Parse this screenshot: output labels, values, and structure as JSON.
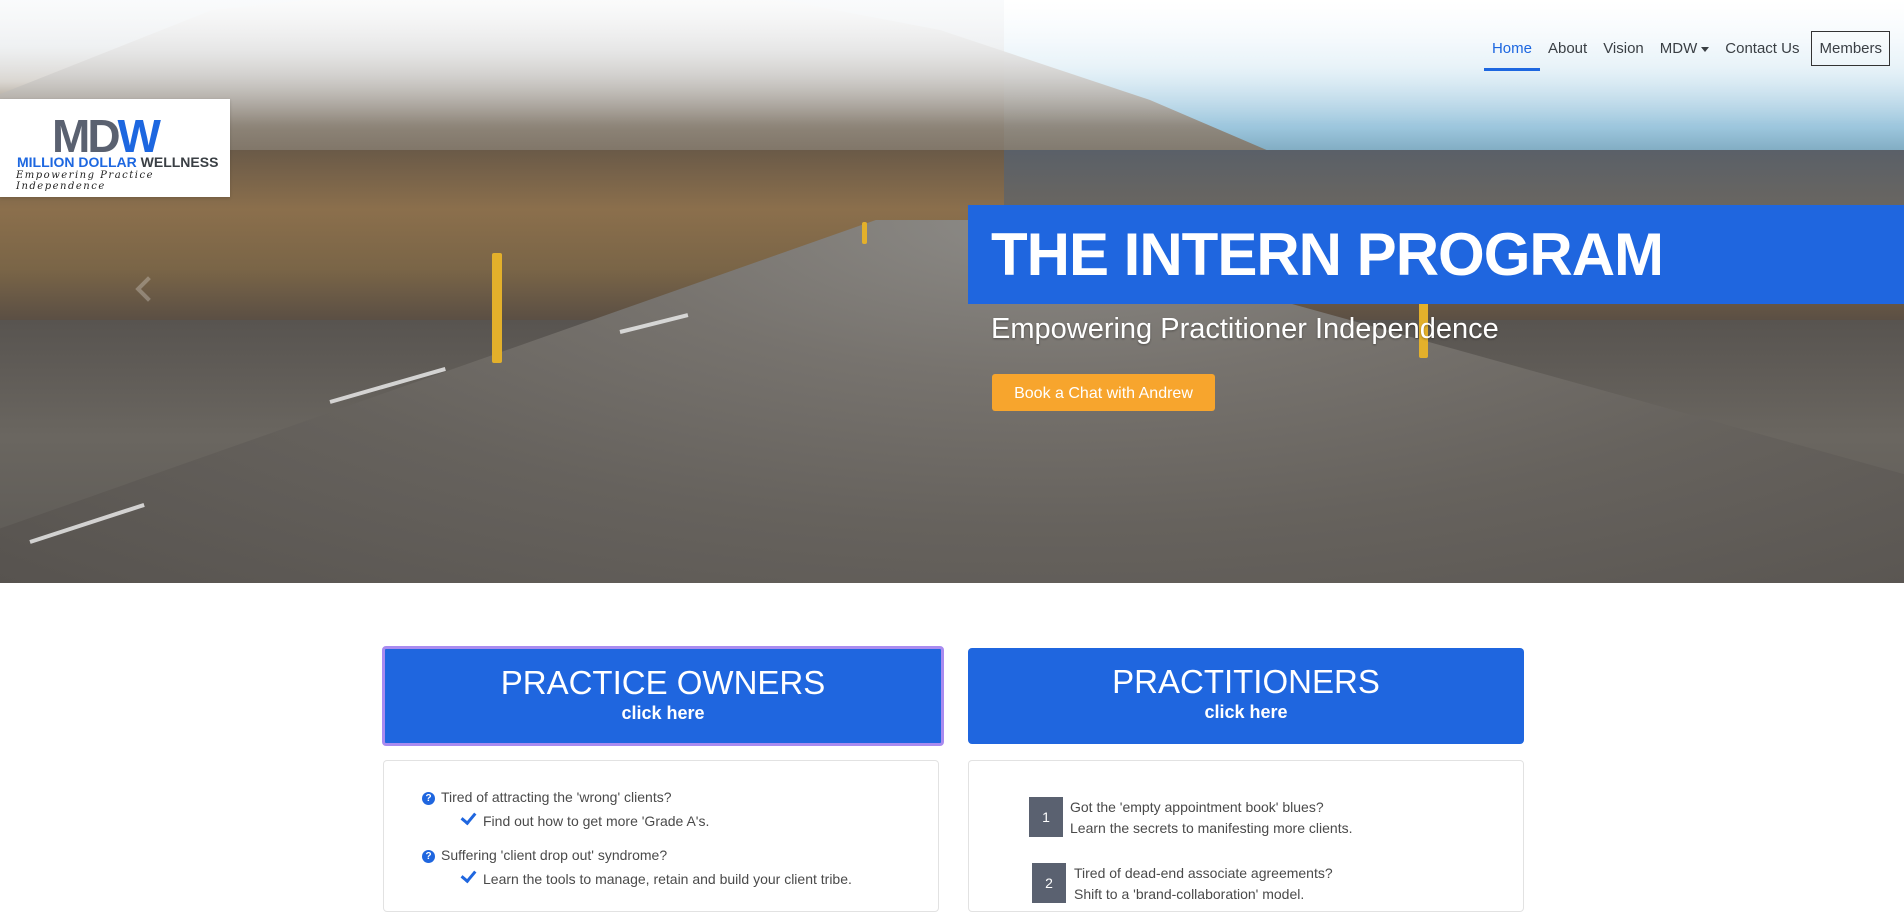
{
  "nav": {
    "items": [
      {
        "label": "Home",
        "active": true
      },
      {
        "label": "About"
      },
      {
        "label": "Vision"
      },
      {
        "label": "MDW",
        "dropdown": true
      },
      {
        "label": "Contact Us"
      }
    ],
    "members_label": "Members"
  },
  "logo": {
    "mark_left": "MD",
    "mark_right": "W",
    "brand_part1": "MILLION DOLLAR",
    "brand_part2": " WELLNESS",
    "tagline": "Empowering  Practice  Independence"
  },
  "hero": {
    "title": "THE INTERN PROGRAM",
    "subtitle": "Empowering Practitioner Independence",
    "cta_label": "Book a Chat with Andrew"
  },
  "cards": {
    "owners": {
      "title": "PRACTICE OWNERS",
      "sub": "click here"
    },
    "practitioners": {
      "title": "PRACTITIONERS",
      "sub": "click here"
    }
  },
  "owners_list": [
    {
      "q": "Tired of attracting the 'wrong' clients?",
      "a": "Find out how to get more 'Grade A's."
    },
    {
      "q": "Suffering 'client drop out' syndrome?",
      "a": "Learn the tools to manage, retain and build your client tribe."
    }
  ],
  "practitioners_list": [
    {
      "n": "1",
      "line1": "Got the 'empty appointment book' blues?",
      "line2": "Learn the secrets to manifesting more clients."
    },
    {
      "n": "2",
      "line1": "Tired of dead-end associate agreements?",
      "line2": "Shift to a 'brand-collaboration' model."
    }
  ],
  "colors": {
    "brand_blue": "#1f66df",
    "cta_orange": "#f7a52d",
    "slate": "#5a6170"
  },
  "icons": [
    "chevron-left-icon",
    "chevron-right-icon",
    "question-circle-icon",
    "check-icon",
    "caret-down-icon"
  ]
}
